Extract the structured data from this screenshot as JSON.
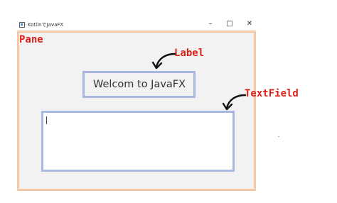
{
  "window": {
    "title": "KotlinでJavaFX",
    "minimize_glyph": "–",
    "maximize_glyph": "□",
    "close_glyph": "✕"
  },
  "pane": {
    "annotation": "Pane"
  },
  "label": {
    "text": "Welcom to JavaFX",
    "annotation": "Label"
  },
  "textfield": {
    "value": "",
    "annotation": "TextField"
  },
  "colors": {
    "annotation": "#e0201a",
    "pane_border": "#f6c8a4",
    "control_border": "#a8b8de",
    "pane_background": "#f2f2f2"
  },
  "icons": [
    "app-icon",
    "minimize-icon",
    "maximize-icon",
    "close-icon",
    "arrow-icon"
  ]
}
